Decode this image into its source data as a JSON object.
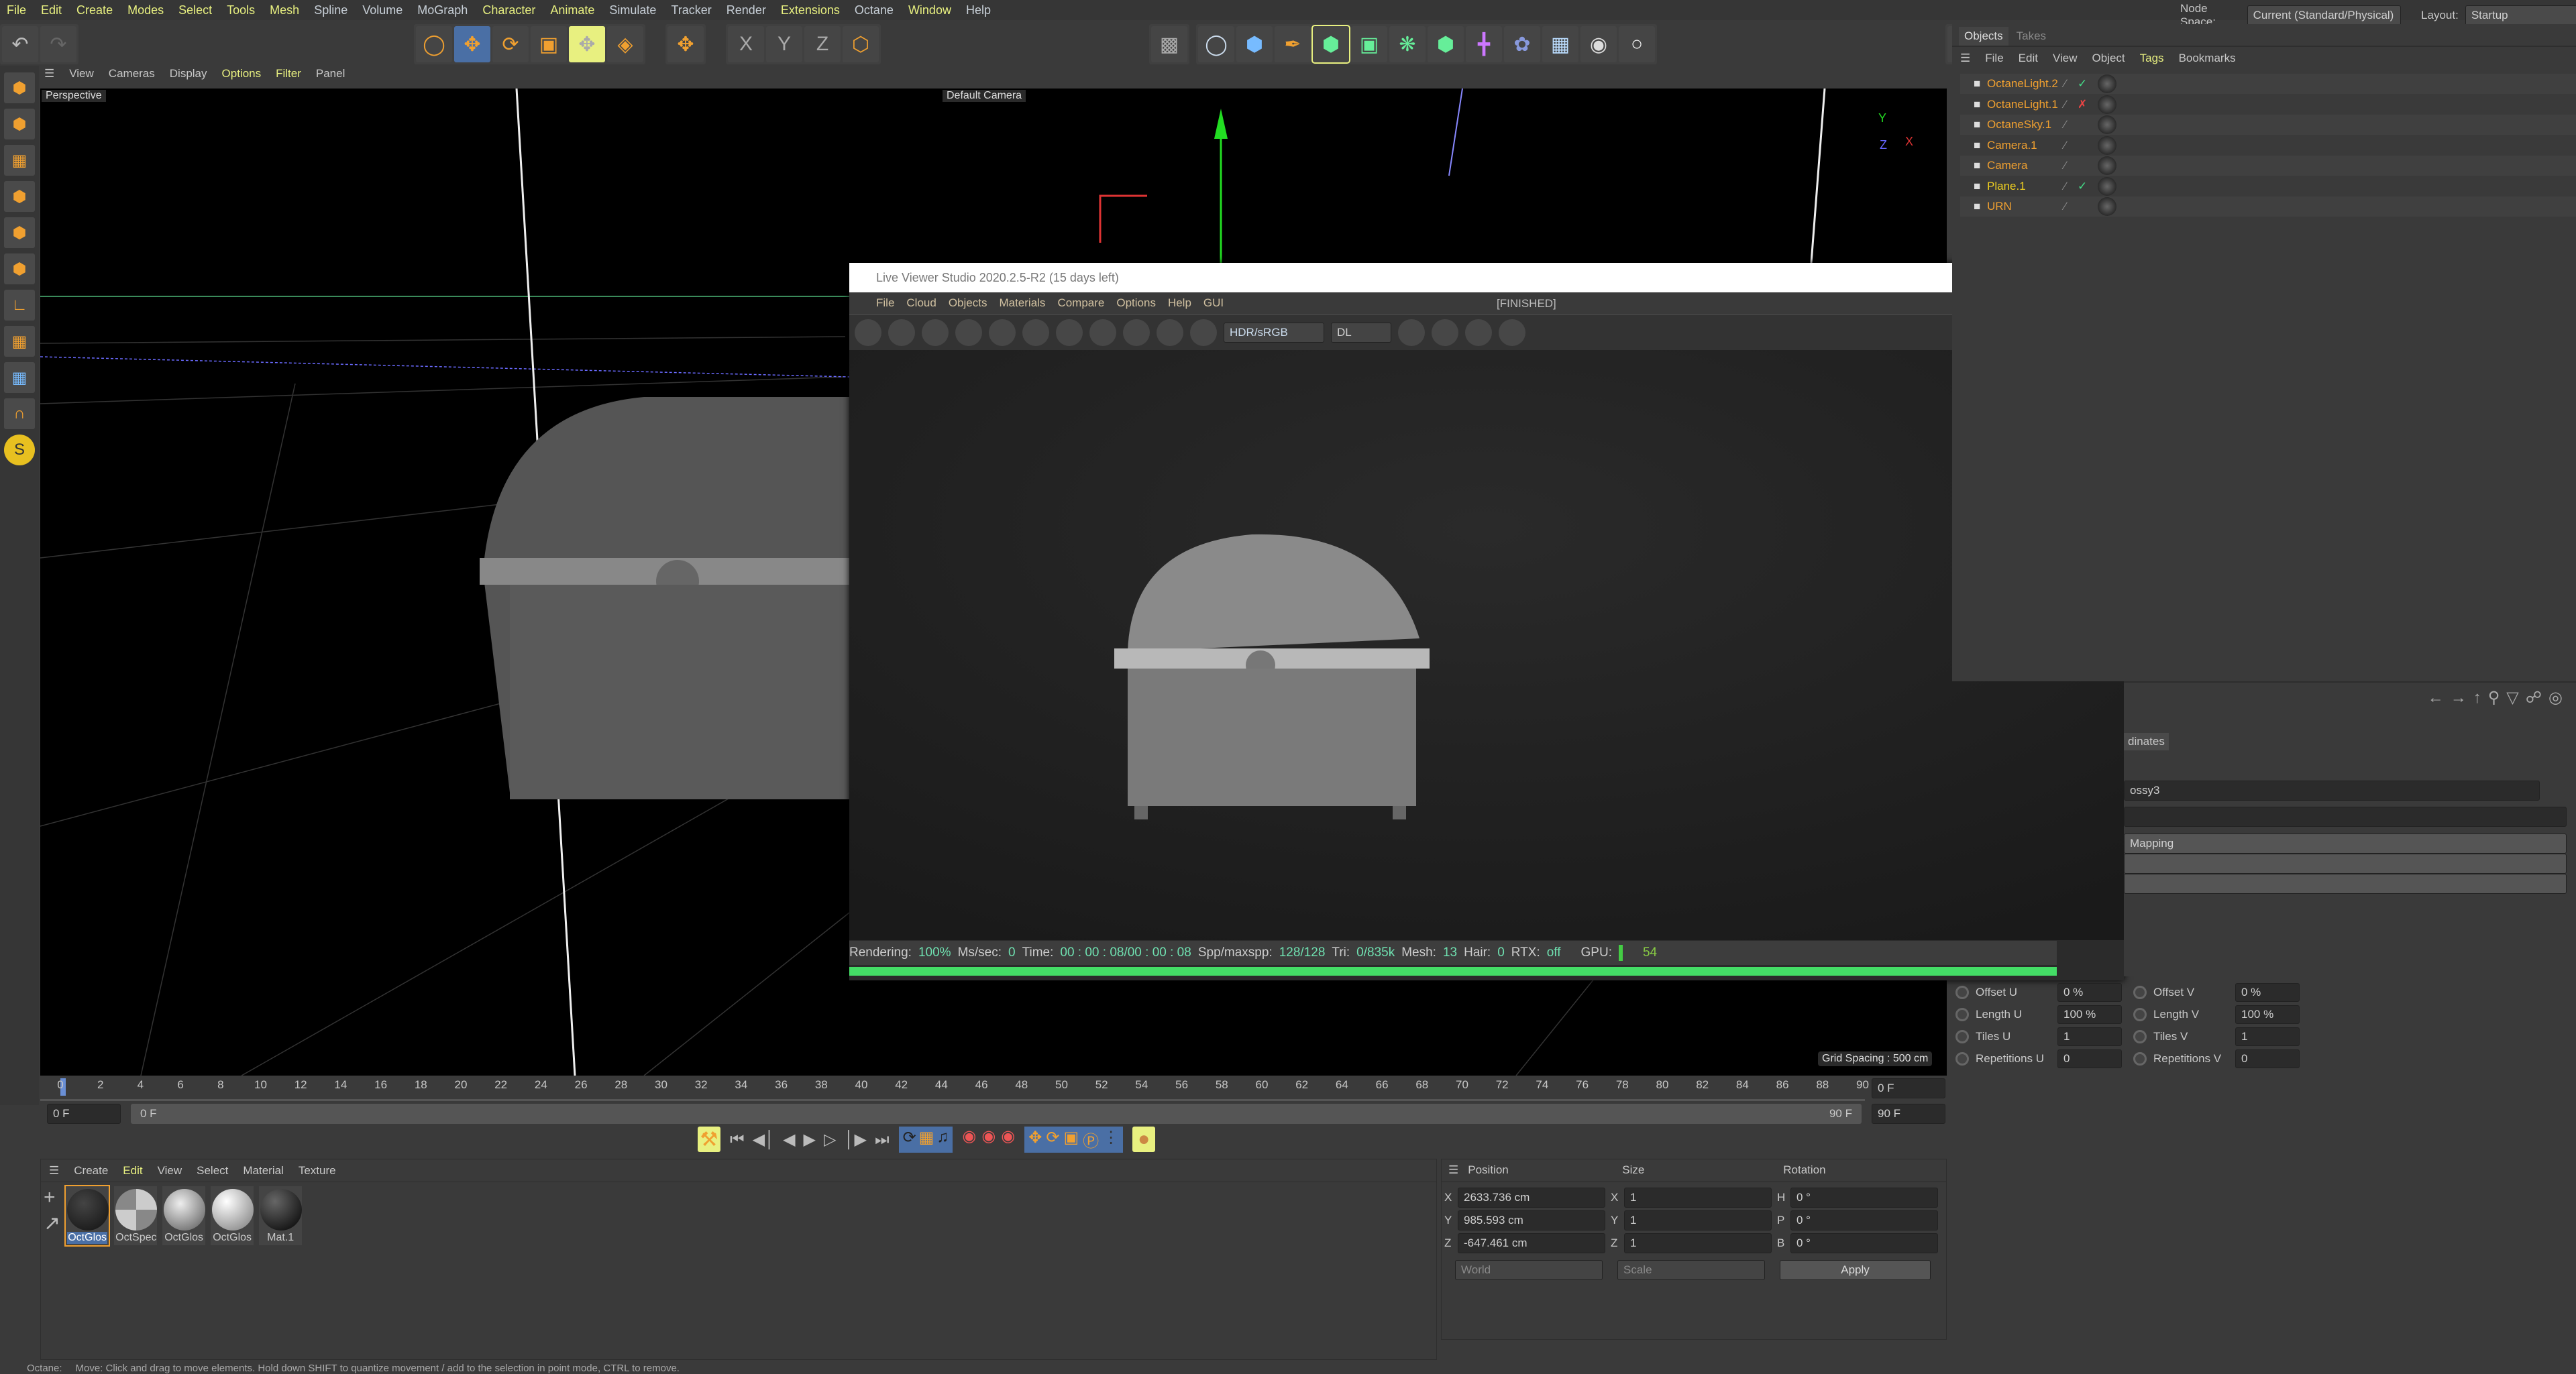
{
  "menu": [
    "File",
    "Edit",
    "Create",
    "Modes",
    "Select",
    "Tools",
    "Mesh",
    "Spline",
    "Volume",
    "MoGraph",
    "Character",
    "Animate",
    "Simulate",
    "Tracker",
    "Render",
    "Extensions",
    "Octane",
    "Window",
    "Help"
  ],
  "node_space": {
    "label": "Node Space:",
    "value": "Current (Standard/Physical)"
  },
  "layout": {
    "label": "Layout:",
    "value": "Startup"
  },
  "viewport": {
    "menu": [
      "View",
      "Cameras",
      "Display",
      "Options",
      "Filter",
      "Panel"
    ],
    "view_name": "Perspective",
    "camera": "Default Camera",
    "grid_spacing": "Grid Spacing : 500 cm"
  },
  "objects_panel": {
    "tabs": [
      "Objects",
      "Takes"
    ],
    "menu": [
      "File",
      "Edit",
      "View",
      "Object",
      "Tags",
      "Bookmarks"
    ],
    "items": [
      {
        "name": "OctaneLight.2",
        "status": "check",
        "icon": "light-icon"
      },
      {
        "name": "OctaneLight.1",
        "status": "cross",
        "icon": "light-icon"
      },
      {
        "name": "OctaneSky.1",
        "status": "",
        "icon": "sky-icon"
      },
      {
        "name": "Camera.1",
        "status": "",
        "icon": "camera-icon"
      },
      {
        "name": "Camera",
        "status": "",
        "icon": "camera-icon"
      },
      {
        "name": "Plane.1",
        "status": "check",
        "icon": "plane-icon"
      },
      {
        "name": "URN",
        "status": "",
        "icon": "null-icon"
      }
    ]
  },
  "live_viewer": {
    "title": "Live Viewer Studio 2020.2.5-R2 (15 days left)",
    "menu": [
      "File",
      "Cloud",
      "Objects",
      "Materials",
      "Compare",
      "Options",
      "Help",
      "GUI"
    ],
    "state": "[FINISHED]",
    "tonemap": "HDR/sRGB",
    "kernel": "DL",
    "status": {
      "rendering_label": "Rendering:",
      "rendering": "100%",
      "ms_label": "Ms/sec:",
      "ms": "0",
      "time_label": "Time:",
      "time": "00 : 00 : 08/00 : 00 : 08",
      "spp_label": "Spp/maxspp:",
      "spp": "128/128",
      "tri_label": "Tri:",
      "tri": "0/835k",
      "mesh_label": "Mesh:",
      "mesh": "13",
      "hair_label": "Hair:",
      "hair": "0",
      "rtx_label": "RTX:",
      "rtx": "off",
      "gpu_label": "GPU:",
      "gpu": "54"
    },
    "progress": 1.0
  },
  "attributes": {
    "tab": "dinates",
    "material": "ossy3",
    "projection": "Mapping",
    "fields": [
      {
        "label": "Offset U",
        "value": "0 %"
      },
      {
        "label": "Offset V",
        "value": "0 %"
      },
      {
        "label": "Length U",
        "value": "100 %"
      },
      {
        "label": "Length V",
        "value": "100 %"
      },
      {
        "label": "Tiles U",
        "value": "1"
      },
      {
        "label": "Tiles V",
        "value": "1"
      },
      {
        "label": "Repetitions U",
        "value": "0"
      },
      {
        "label": "Repetitions V",
        "value": "0"
      }
    ]
  },
  "timeline": {
    "ticks": [
      0,
      2,
      4,
      6,
      8,
      10,
      12,
      14,
      16,
      18,
      20,
      22,
      24,
      26,
      28,
      30,
      32,
      34,
      36,
      38,
      40,
      42,
      44,
      46,
      48,
      50,
      52,
      54,
      56,
      58,
      60,
      62,
      64,
      66,
      68,
      70,
      72,
      74,
      76,
      78,
      80,
      82,
      84,
      86,
      88,
      90
    ],
    "current": "0 F",
    "start": "0 F",
    "range_start": "0 F",
    "range_end": "90 F",
    "end": "90 F",
    "end2": "90 F"
  },
  "materials": {
    "menu": [
      "Create",
      "Edit",
      "View",
      "Select",
      "Material",
      "Texture"
    ],
    "items": [
      "OctGlos",
      "OctSpec",
      "OctGlos",
      "OctGlos",
      "Mat.1"
    ]
  },
  "coords": {
    "headers": [
      "Position",
      "Size",
      "Rotation"
    ],
    "position": [
      {
        "axis": "X",
        "value": "2633.736 cm"
      },
      {
        "axis": "Y",
        "value": "985.593 cm"
      },
      {
        "axis": "Z",
        "value": "-647.461 cm"
      }
    ],
    "size": [
      {
        "axis": "X",
        "value": "1"
      },
      {
        "axis": "Y",
        "value": "1"
      },
      {
        "axis": "Z",
        "value": "1"
      }
    ],
    "rotation": [
      {
        "axis": "H",
        "value": "0 °"
      },
      {
        "axis": "P",
        "value": "0 °"
      },
      {
        "axis": "B",
        "value": "0 °"
      }
    ],
    "mode": "World",
    "size_mode": "Scale",
    "apply": "Apply"
  },
  "status_bar": {
    "prefix": "Octane:",
    "text": "Move: Click and drag to move elements. Hold down SHIFT to quantize movement / add to the selection in point mode, CTRL to remove."
  },
  "colors": {
    "accent_yellow": "#e8f080",
    "object_orange": "#f0a030",
    "progress_green": "#44dd66",
    "selected_blue": "#4a6fa5"
  }
}
